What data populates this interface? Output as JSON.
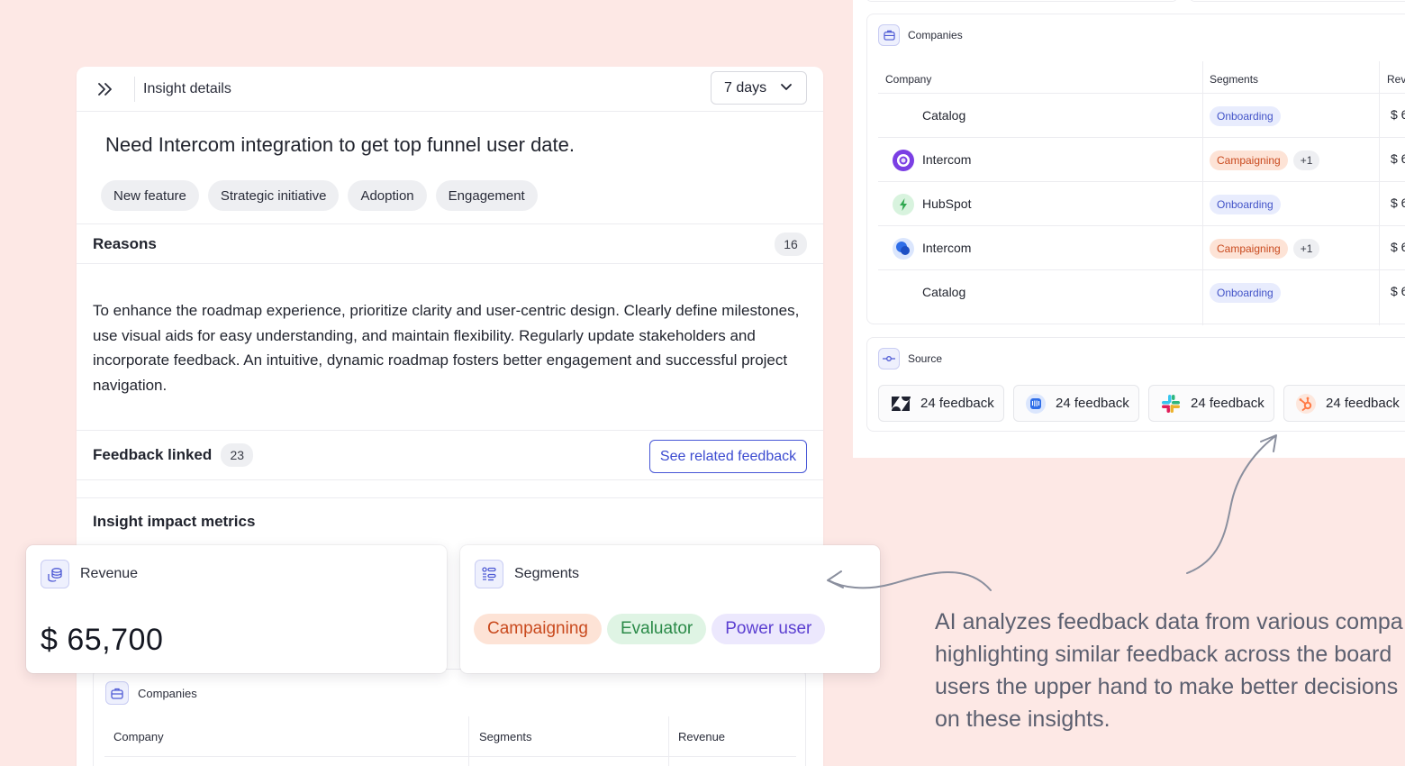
{
  "panel": {
    "header_title": "Insight details",
    "range_select": "7 days",
    "insight_title": "Need Intercom integration to get top funnel user date.",
    "tags": [
      "New feature",
      "Strategic initiative",
      "Adoption",
      "Engagement"
    ],
    "reasons": {
      "title": "Reasons",
      "count": "16",
      "text": "To enhance the roadmap experience, prioritize clarity and user-centric design. Clearly define milestones, use visual aids for easy understanding, and maintain flexibility. Regularly update stakeholders and incorporate feedback. An intuitive, dynamic roadmap fosters better engagement and successful project navigation."
    },
    "feedback": {
      "title": "Feedback linked",
      "count": "23",
      "button": "See related feedback"
    },
    "metrics": {
      "title": "Insight impact metrics"
    },
    "companies": {
      "label": "Companies",
      "columns": [
        "Company",
        "Segments",
        "Revenue"
      ]
    }
  },
  "revenue_card": {
    "label": "Revenue",
    "value": "$ 65,700"
  },
  "segments_card": {
    "label": "Segments",
    "pills": [
      "Campaigning",
      "Evaluator",
      "Power user"
    ]
  },
  "right_panel": {
    "companies": {
      "label": "Companies",
      "columns": [
        "Company",
        "Segments",
        "Rev"
      ],
      "rows": [
        {
          "name": "Catalog",
          "segment": "Onboarding",
          "revenue": "$ 6"
        },
        {
          "name": "Intercom",
          "segment": "Campaigning",
          "extra": "+1",
          "revenue": "$ 6"
        },
        {
          "name": "HubSpot",
          "segment": "Onboarding",
          "revenue": "$ 6"
        },
        {
          "name": "Intercom",
          "segment": "Campaigning",
          "extra": "+1",
          "revenue": "$ 6"
        },
        {
          "name": "Catalog",
          "segment": "Onboarding",
          "revenue": "$ 6"
        }
      ]
    },
    "source": {
      "label": "Source",
      "items": [
        {
          "icon": "zendesk-icon",
          "label": "24 feedback"
        },
        {
          "icon": "intercom-icon",
          "label": "24 feedback"
        },
        {
          "icon": "slack-icon",
          "label": "24 feedback"
        },
        {
          "icon": "hubspot-icon",
          "label": "24 feedback"
        }
      ]
    }
  },
  "caption": {
    "lines": [
      "AI analyzes feedback data from various compa",
      "highlighting similar feedback across the board",
      "users the upper hand to make better decisions",
      "on these insights."
    ]
  },
  "colors": {
    "accent": "#4756d6",
    "background": "#fde8e5"
  }
}
